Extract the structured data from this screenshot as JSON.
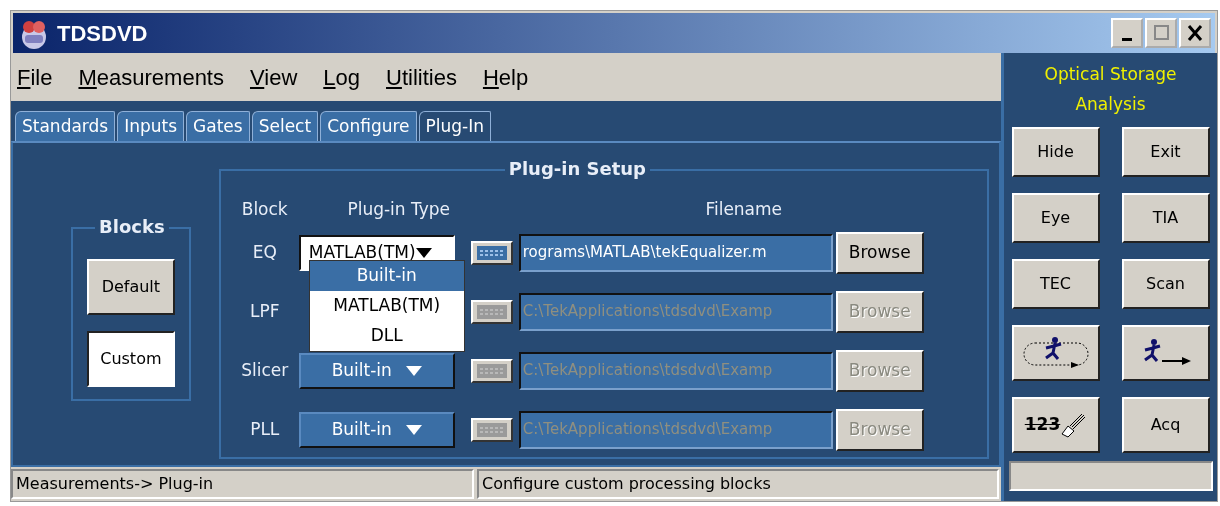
{
  "window": {
    "title": "TDSDVD"
  },
  "menu": [
    "File",
    "Measurements",
    "View",
    "Log",
    "Utilities",
    "Help"
  ],
  "tabs": [
    {
      "label": "Standards",
      "selected": false
    },
    {
      "label": "Inputs",
      "selected": false
    },
    {
      "label": "Gates",
      "selected": false
    },
    {
      "label": "Select",
      "selected": false
    },
    {
      "label": "Configure",
      "selected": false
    },
    {
      "label": "Plug-In",
      "selected": true
    }
  ],
  "blocks": {
    "title": "Blocks",
    "buttons": [
      {
        "label": "Default",
        "selected": false
      },
      {
        "label": "Custom",
        "selected": true
      }
    ]
  },
  "setup": {
    "title": "Plug-in Setup",
    "headers": [
      "Block",
      "Plug-in Type",
      "Filename"
    ],
    "rows": [
      {
        "block": "EQ",
        "type": "MATLAB(TM)",
        "open": true,
        "disabled": false,
        "filename": "rograms\\MATLAB\\tekEqualizer.m",
        "browse": "Browse"
      },
      {
        "block": "LPF",
        "disabled": true,
        "filename": "C:\\TekApplications\\tdsdvd\\Examp",
        "browse": "Browse"
      },
      {
        "block": "Slicer",
        "type": "Built-in",
        "open": false,
        "disabled": true,
        "filename": "C:\\TekApplications\\tdsdvd\\Examp",
        "browse": "Browse"
      },
      {
        "block": "PLL",
        "type": "Built-in",
        "open": false,
        "disabled": true,
        "filename": "C:\\TekApplications\\tdsdvd\\Examp",
        "browse": "Browse"
      }
    ],
    "dropdown_options": [
      {
        "label": "Built-in",
        "selected": true
      },
      {
        "label": "MATLAB(TM)",
        "selected": false
      },
      {
        "label": "DLL",
        "selected": false
      }
    ]
  },
  "side_panel": {
    "title": "Optical Storage Analysis",
    "buttons": [
      {
        "kind": "text",
        "label": "Hide"
      },
      {
        "kind": "text",
        "label": "Exit"
      },
      {
        "kind": "text",
        "label": "Eye"
      },
      {
        "kind": "text",
        "label": "TIA"
      },
      {
        "kind": "text",
        "label": "TEC"
      },
      {
        "kind": "text",
        "label": "Scan"
      },
      {
        "kind": "run-loop"
      },
      {
        "kind": "run-once"
      },
      {
        "kind": "clear",
        "label": "123"
      },
      {
        "kind": "text",
        "label": "Acq"
      }
    ]
  },
  "status_bar": [
    "Measurements-> Plug-in",
    "Configure custom processing blocks"
  ]
}
